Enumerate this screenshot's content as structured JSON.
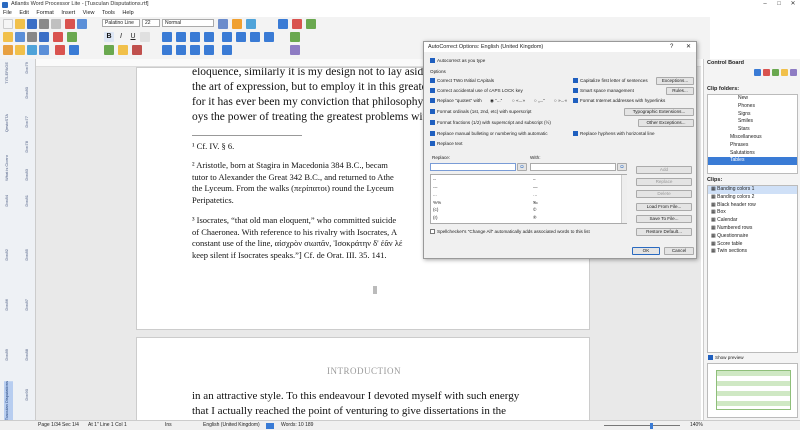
{
  "window": {
    "title": "Atlantis Word Processor Lite - [Tusculan Disputations.rtf]"
  },
  "menu": [
    "File",
    "Edit",
    "Format",
    "Insert",
    "View",
    "Tools",
    "Help"
  ],
  "toolbar": {
    "font": "Palatino Line",
    "size": "22",
    "style": "Normal"
  },
  "navpane": [
    "Doc79",
    "Doc80",
    "TITLEPAGE",
    "Doc77",
    "Doc78",
    "QestoSTA",
    "What is Cicero",
    "Doc83",
    "Doc81",
    "Doc84",
    "Doc85",
    "Doc82",
    "Doc87",
    "Doc86",
    "Doc88",
    "Doc89",
    "Doc90",
    "Tusculan Disputations"
  ],
  "page1": {
    "lines": [
      "eloquence, similarly it is my design not to lay aside",
      "the art of expression, but to employ it in this greater",
      "for it has ever been my conviction that philosophy al",
      "oys the power of treating the greatest problems with"
    ],
    "fn1": "¹ Cf. IV. § 6.",
    "fn2": [
      "² Aristotle, born at Stagira in Macedonia 384 B.C., becam",
      "tutor to Alexander the Great 342 B.C., and returned to Athe",
      "the Lyceum. From the walks (περίπατοι) round the Lyceum",
      "Peripatetics."
    ],
    "fn3": [
      "³ Isocrates, “that old man eloquent,” who committed suicide",
      "of Chaeronea. With reference to his rivalry with Isocrates, A",
      "constant use of the line, αἰσχρὸν σιωπᾶν, Ἰσοκράτην δ' ἐᾶν λέ",
      "keep silent if Isocrates speaks.”] Cf. de Orat. III. 35. 141."
    ]
  },
  "page2": {
    "heading": "INTRODUCTION",
    "lines": [
      "in an attractive style. To this endeavour I devoted myself with such energy",
      "that I actually reached the point of venturing to give dissertations in the"
    ]
  },
  "dialog": {
    "title": "AutoCorrect Options: English (United Kingdom)",
    "help": "?",
    "close": "✕",
    "autocorrect_label": "Autocorrect as you type",
    "options_label": "Options",
    "opts": [
      "Correct TWo INitial CApitals",
      "Capitalize first letter of sentences",
      "Correct accidental use of cAPS LOCK key",
      "Smart space management",
      "Replace \"quotes\" with",
      "Format Internet addresses with hyperlinks",
      "Format ordinals (1st, 2nd, etc) with superscript",
      "Format fractions (1/2) with superscript and subscript (½)",
      "Replace manual bulleting or numbering with automatic",
      "Replace hyphens with horizontal line",
      "Replace text"
    ],
    "quotes": [
      "“...”",
      "«...»",
      "„...“",
      "»...«"
    ],
    "buttons": {
      "exceptions": "Exceptions...",
      "rules": "Rules...",
      "punct": "Typographic Extensions...",
      "other": "Other Exceptions...",
      "add": "Add",
      "replace": "Replace",
      "delete": "Delete",
      "load": "Load From File...",
      "save": "Save To File...",
      "restore": "Restore Default...",
      "ok": "OK",
      "cancel": "Cancel"
    },
    "replace_label": "Replace:",
    "with_label": "With:",
    "table": [
      [
        "--",
        "–"
      ],
      [
        "---",
        "—"
      ],
      [
        "...",
        "…"
      ],
      [
        "%%",
        "‰"
      ],
      [
        "(c)",
        "©"
      ],
      [
        "(r)",
        "®"
      ]
    ],
    "spell": "Spellchecker's \"Change All\" automatically adds associated words to this list"
  },
  "rightpanel": {
    "title": "Control Board",
    "folders_label": "Clip folders:",
    "folders": [
      "New",
      "Phones",
      "Signs",
      "Smiles",
      "Stars",
      "Miscellaneous",
      "Phrases",
      "Salutations",
      "Tables"
    ],
    "clips_label": "Clips:",
    "clips": [
      "Banding colors 1",
      "Banding colors 2",
      "Black header row",
      "Box",
      "Calendar",
      "Numbered rows",
      "Questionnaire",
      "Score table",
      "Twin sections"
    ],
    "preview": "Show preview"
  },
  "status": {
    "page": "Page 1/34",
    "sec": "Sec 1/4",
    "at": "At 1\"  Line 1  Col 1",
    "ins": "Ins",
    "lang": "English (United Kingdom)",
    "words": "Words: 10 189",
    "zoom": "140%"
  }
}
